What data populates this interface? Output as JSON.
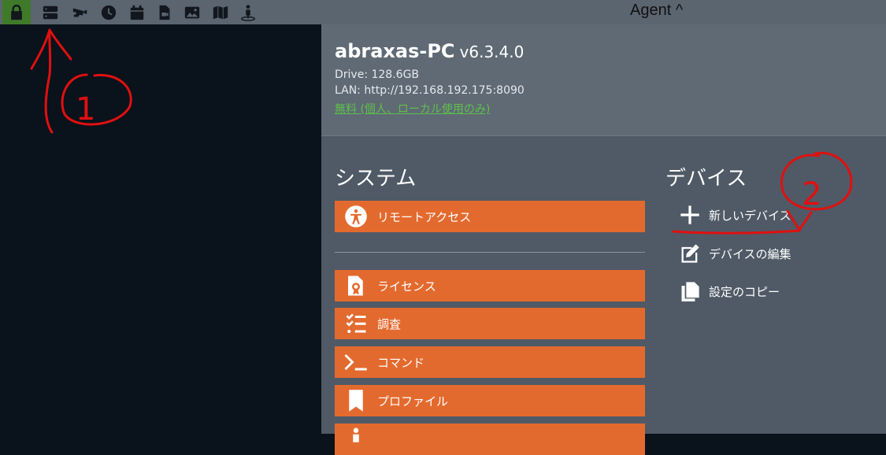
{
  "topbar": {
    "icons": [
      "lock-icon",
      "server-icon",
      "camera-icon",
      "clock-icon",
      "calendar-icon",
      "file-video-icon",
      "image-icon",
      "map-icon",
      "agent-icon"
    ],
    "menu_label": "Agent ^"
  },
  "header": {
    "pc_name": "abraxas-PC",
    "version": "v6.3.4.0",
    "drive": "Drive: 128.6GB",
    "lan": "LAN: http://192.168.192.175:8090",
    "license": "無料 (個人、ローカル使用のみ)"
  },
  "system": {
    "title": "システム",
    "remote_access": "リモートアクセス",
    "items": [
      "ライセンス",
      "調査",
      "コマンド",
      "プロファイル"
    ]
  },
  "devices": {
    "title": "デバイス",
    "items": [
      "新しいデバイス",
      "デバイスの編集",
      "設定のコピー"
    ]
  },
  "annotations": [
    "1",
    "2"
  ],
  "colors": {
    "accent": "#e36a2e",
    "topbar": "#5b6570",
    "lock_active": "#3f7a2a",
    "license_link": "#5fc04a",
    "annotation": "#e01010"
  }
}
